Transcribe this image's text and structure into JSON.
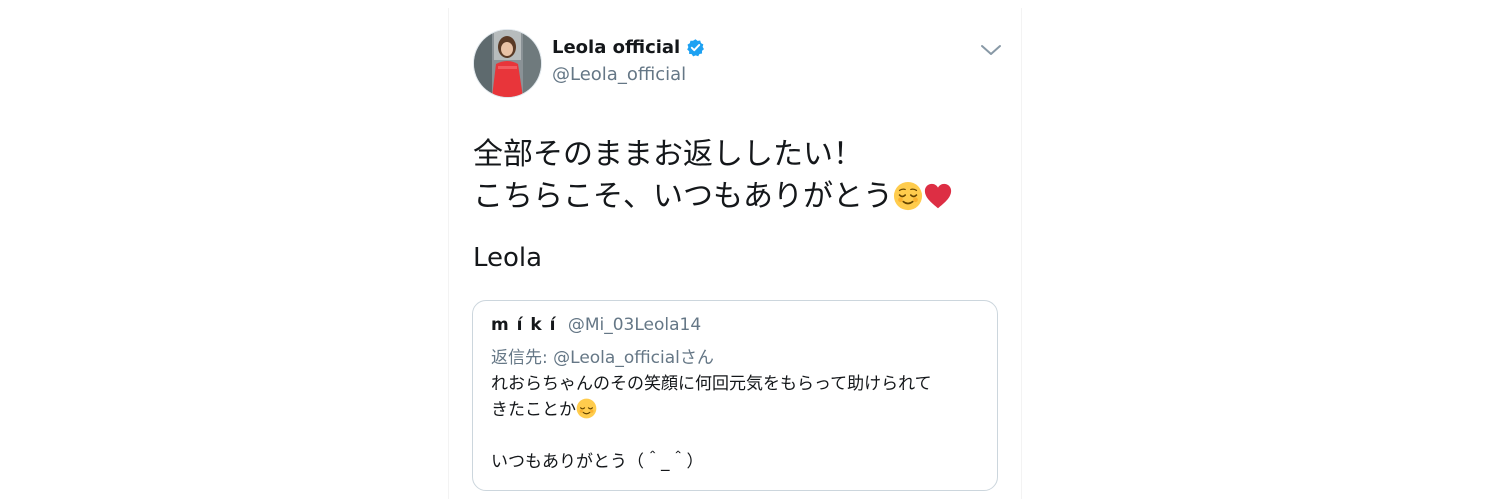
{
  "tweet": {
    "display_name": "Leola official",
    "handle": "@Leola_official",
    "verified": true,
    "body_lines": [
      "全部そのままお返ししたい！",
      "こちらこそ、いつもありがとう"
    ],
    "body_emojis": [
      "relieved-face-emoji",
      "red-heart-emoji"
    ],
    "signature": "Leola"
  },
  "quoted_tweet": {
    "display_name": "m í k í",
    "handle": "@Mi_03Leola14",
    "reply_prefix": "返信先: ",
    "reply_handle": "@Leola_official",
    "reply_suffix": "さん",
    "body_lines": [
      "れおらちゃんのその笑顔に何回元気をもらって助けられて",
      "きたことか",
      "",
      "いつもありがとう（＾_＾）"
    ],
    "body_emoji": "relieved-face-emoji"
  },
  "colors": {
    "text": "#14171a",
    "secondary_text": "#657786",
    "verified_blue": "#1da1f2",
    "border": "#ccd6dd"
  }
}
